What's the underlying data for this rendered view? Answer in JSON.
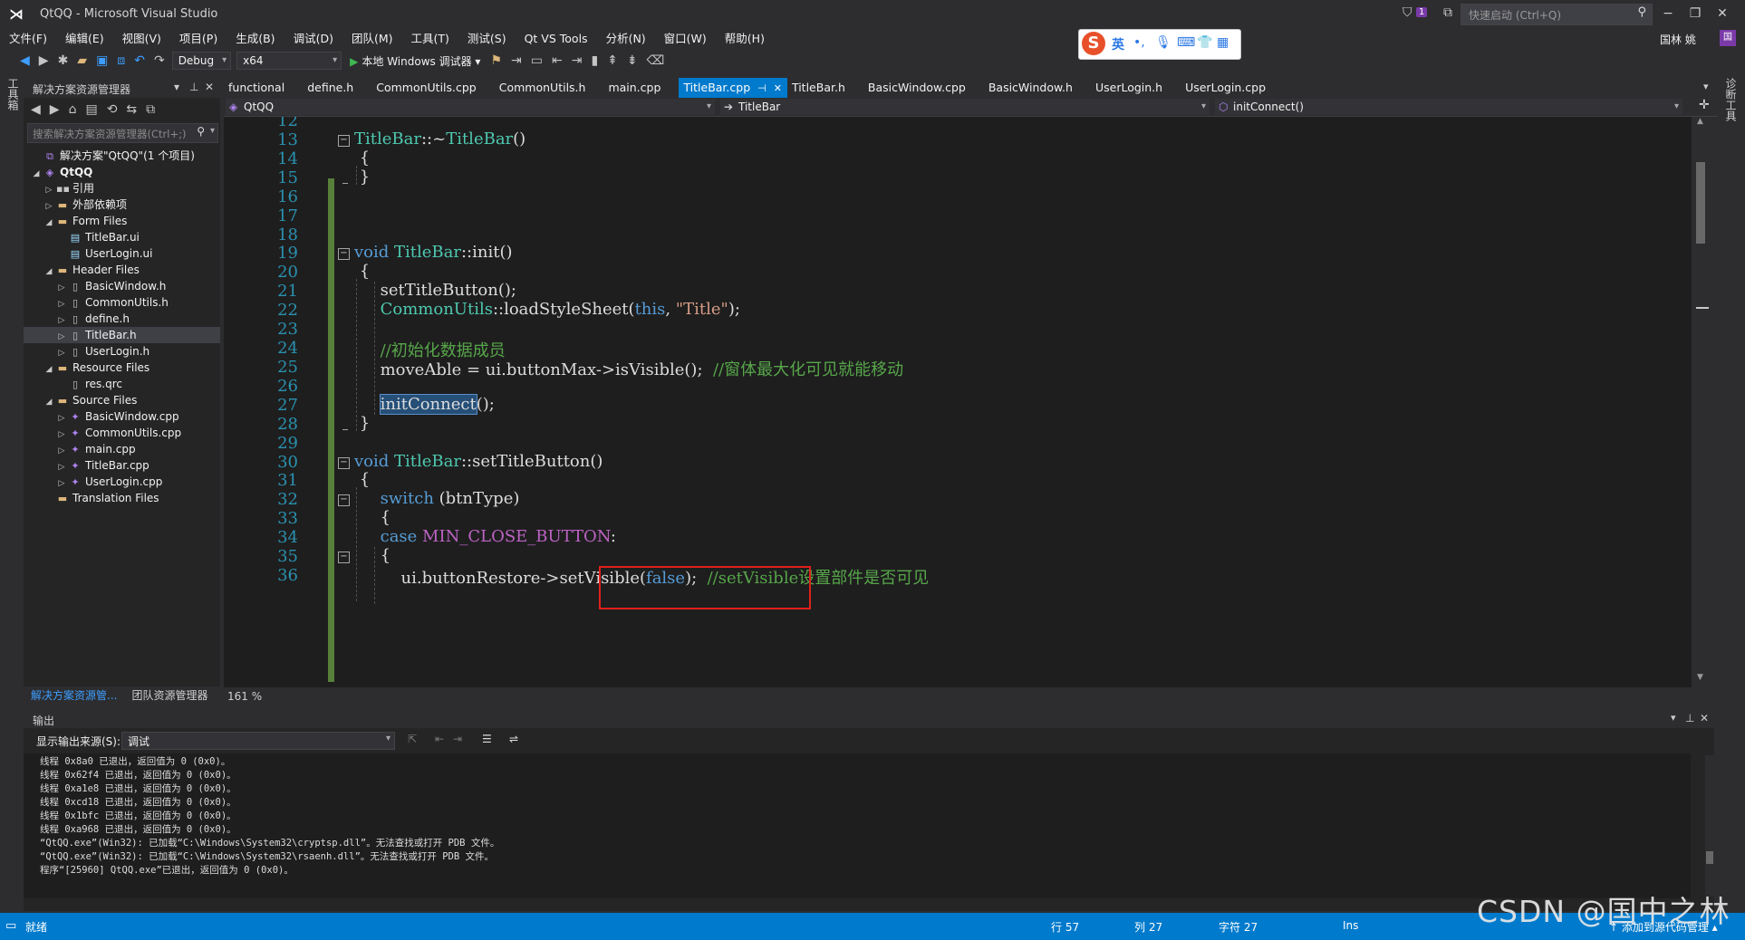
{
  "window": {
    "title": "QtQQ - Microsoft Visual Studio",
    "notification_count": "1"
  },
  "quick_launch": {
    "placeholder": "快速启动 (Ctrl+Q)"
  },
  "user": {
    "name": "国林 姚",
    "avatar": "国"
  },
  "menu": [
    "文件(F)",
    "编辑(E)",
    "视图(V)",
    "项目(P)",
    "生成(B)",
    "调试(D)",
    "团队(M)",
    "工具(T)",
    "测试(S)",
    "Qt VS Tools",
    "分析(N)",
    "窗口(W)",
    "帮助(H)"
  ],
  "ime": {
    "logo": "S",
    "lang": "英"
  },
  "toolbar": {
    "config": "Debug",
    "platform": "x64",
    "run_label": "本地 Windows 调试器"
  },
  "left_strip": {
    "label": "工具箱"
  },
  "right_strip": {
    "label": "诊断工具"
  },
  "solution_explorer": {
    "title": "解决方案资源管理器",
    "search_placeholder": "搜索解决方案资源管理器(Ctrl+;)",
    "tree": [
      {
        "label": "解决方案\"QtQQ\"(1 个项目)",
        "depth": 0,
        "twisty": "",
        "icon": "sln",
        "bold": false,
        "selected": false
      },
      {
        "label": "QtQQ",
        "depth": 0,
        "twisty": "◢",
        "icon": "proj",
        "bold": true,
        "selected": false
      },
      {
        "label": "引用",
        "depth": 1,
        "twisty": "▷",
        "icon": "ref",
        "bold": false,
        "selected": false
      },
      {
        "label": "外部依赖项",
        "depth": 1,
        "twisty": "▷",
        "icon": "folder",
        "bold": false,
        "selected": false
      },
      {
        "label": "Form Files",
        "depth": 1,
        "twisty": "◢",
        "icon": "folder",
        "bold": false,
        "selected": false
      },
      {
        "label": "TitleBar.ui",
        "depth": 2,
        "twisty": "",
        "icon": "ui",
        "bold": false,
        "selected": false
      },
      {
        "label": "UserLogin.ui",
        "depth": 2,
        "twisty": "",
        "icon": "ui",
        "bold": false,
        "selected": false
      },
      {
        "label": "Header Files",
        "depth": 1,
        "twisty": "◢",
        "icon": "folder",
        "bold": false,
        "selected": false
      },
      {
        "label": "BasicWindow.h",
        "depth": 2,
        "twisty": "▷",
        "icon": "h",
        "bold": false,
        "selected": false
      },
      {
        "label": "CommonUtils.h",
        "depth": 2,
        "twisty": "▷",
        "icon": "h",
        "bold": false,
        "selected": false
      },
      {
        "label": "define.h",
        "depth": 2,
        "twisty": "▷",
        "icon": "h",
        "bold": false,
        "selected": false
      },
      {
        "label": "TitleBar.h",
        "depth": 2,
        "twisty": "▷",
        "icon": "h",
        "bold": false,
        "selected": true
      },
      {
        "label": "UserLogin.h",
        "depth": 2,
        "twisty": "▷",
        "icon": "h",
        "bold": false,
        "selected": false
      },
      {
        "label": "Resource Files",
        "depth": 1,
        "twisty": "◢",
        "icon": "folder",
        "bold": false,
        "selected": false
      },
      {
        "label": "res.qrc",
        "depth": 2,
        "twisty": "",
        "icon": "h",
        "bold": false,
        "selected": false
      },
      {
        "label": "Source Files",
        "depth": 1,
        "twisty": "◢",
        "icon": "folder",
        "bold": false,
        "selected": false
      },
      {
        "label": "BasicWindow.cpp",
        "depth": 2,
        "twisty": "▷",
        "icon": "cpp",
        "bold": false,
        "selected": false
      },
      {
        "label": "CommonUtils.cpp",
        "depth": 2,
        "twisty": "▷",
        "icon": "cpp",
        "bold": false,
        "selected": false
      },
      {
        "label": "main.cpp",
        "depth": 2,
        "twisty": "▷",
        "icon": "cpp",
        "bold": false,
        "selected": false
      },
      {
        "label": "TitleBar.cpp",
        "depth": 2,
        "twisty": "▷",
        "icon": "cpp",
        "bold": false,
        "selected": false
      },
      {
        "label": "UserLogin.cpp",
        "depth": 2,
        "twisty": "▷",
        "icon": "cpp",
        "bold": false,
        "selected": false
      },
      {
        "label": "Translation Files",
        "depth": 1,
        "twisty": "",
        "icon": "folder",
        "bold": false,
        "selected": false
      }
    ],
    "bottom_tabs": {
      "active": "解决方案资源管...",
      "inactive": "团队资源管理器"
    }
  },
  "doc_tabs": [
    {
      "label": "functional",
      "active": false
    },
    {
      "label": "define.h",
      "active": false
    },
    {
      "label": "CommonUtils.cpp",
      "active": false
    },
    {
      "label": "CommonUtils.h",
      "active": false
    },
    {
      "label": "main.cpp",
      "active": false
    },
    {
      "label": "TitleBar.cpp",
      "active": true
    },
    {
      "label": "TitleBar.h",
      "active": false
    },
    {
      "label": "BasicWindow.cpp",
      "active": false
    },
    {
      "label": "BasicWindow.h",
      "active": false
    },
    {
      "label": "UserLogin.h",
      "active": false
    },
    {
      "label": "UserLogin.cpp",
      "active": false
    }
  ],
  "navbar": {
    "project": "QtQQ",
    "scope": "TitleBar",
    "member": "initConnect()"
  },
  "editor": {
    "zoom": "161 %",
    "lines": [
      {
        "n": "12",
        "tokens": []
      },
      {
        "n": "13",
        "tokens": [
          [
            "ty",
            "TitleBar"
          ],
          [
            "p",
            "::~"
          ],
          [
            "ty",
            "TitleBar"
          ],
          [
            "p",
            "()"
          ]
        ]
      },
      {
        "n": "14",
        "tokens": [
          [
            "p",
            " {"
          ]
        ]
      },
      {
        "n": "15",
        "tokens": [
          [
            "p",
            " }"
          ]
        ]
      },
      {
        "n": "16",
        "tokens": []
      },
      {
        "n": "17",
        "tokens": []
      },
      {
        "n": "18",
        "tokens": []
      },
      {
        "n": "19",
        "tokens": [
          [
            "kw",
            "void "
          ],
          [
            "ty",
            "TitleBar"
          ],
          [
            "p",
            "::init()"
          ]
        ]
      },
      {
        "n": "20",
        "tokens": [
          [
            "p",
            " {"
          ]
        ]
      },
      {
        "n": "21",
        "tokens": [
          [
            "p",
            "     setTitleButton();"
          ]
        ]
      },
      {
        "n": "22",
        "tokens": [
          [
            "p",
            "     "
          ],
          [
            "ty",
            "CommonUtils"
          ],
          [
            "p",
            "::loadStyleSheet("
          ],
          [
            "kw",
            "this"
          ],
          [
            "p",
            ", "
          ],
          [
            "str",
            "\"Title\""
          ],
          [
            "p",
            ");"
          ]
        ]
      },
      {
        "n": "23",
        "tokens": []
      },
      {
        "n": "24",
        "tokens": [
          [
            "cm",
            "     //初始化数据成员"
          ]
        ]
      },
      {
        "n": "25",
        "tokens": [
          [
            "p",
            "     moveAble = ui.buttonMax->isVisible();  "
          ],
          [
            "cm",
            "//窗体最大化可见就能移动"
          ]
        ]
      },
      {
        "n": "26",
        "tokens": []
      },
      {
        "n": "27",
        "tokens": [
          [
            "p",
            "     "
          ],
          [
            "hl",
            "initConnect"
          ],
          [
            "p",
            "();"
          ]
        ]
      },
      {
        "n": "28",
        "tokens": [
          [
            "p",
            " }"
          ]
        ]
      },
      {
        "n": "29",
        "tokens": []
      },
      {
        "n": "30",
        "tokens": [
          [
            "kw",
            "void "
          ],
          [
            "ty",
            "TitleBar"
          ],
          [
            "p",
            "::setTitleButton()"
          ]
        ]
      },
      {
        "n": "31",
        "tokens": [
          [
            "p",
            " {"
          ]
        ]
      },
      {
        "n": "32",
        "tokens": [
          [
            "kw",
            "     switch "
          ],
          [
            "p",
            "(btnType)"
          ]
        ]
      },
      {
        "n": "33",
        "tokens": [
          [
            "p",
            "     {"
          ]
        ]
      },
      {
        "n": "34",
        "tokens": [
          [
            "kw",
            "     case "
          ],
          [
            "mac",
            "MIN_CLOSE_BUTTON"
          ],
          [
            "p",
            ":"
          ]
        ]
      },
      {
        "n": "35",
        "tokens": [
          [
            "p",
            "     {"
          ]
        ]
      },
      {
        "n": "36",
        "tokens": [
          [
            "p",
            "         ui.buttonRestore->setVisible("
          ],
          [
            "kw",
            "false"
          ],
          [
            "p",
            ");  "
          ],
          [
            "cm",
            "//setVisible设置部件是否可见"
          ]
        ]
      }
    ]
  },
  "output": {
    "title": "输出",
    "source_label": "显示输出来源(S):",
    "source_value": "调试",
    "lines": [
      "线程 0x8a0 已退出，返回值为 0 (0x0)。",
      "线程 0x62f4 已退出，返回值为 0 (0x0)。",
      "线程 0xa1e8 已退出，返回值为 0 (0x0)。",
      "线程 0xcd18 已退出，返回值为 0 (0x0)。",
      "线程 0x1bfc 已退出，返回值为 0 (0x0)。",
      "线程 0xa968 已退出，返回值为 0 (0x0)。",
      "“QtQQ.exe”(Win32): 已加载“C:\\Windows\\System32\\cryptsp.dll”。无法查找或打开 PDB 文件。",
      "“QtQQ.exe”(Win32): 已加载“C:\\Windows\\System32\\rsaenh.dll”。无法查找或打开 PDB 文件。",
      "程序“[25960] QtQQ.exe”已退出，返回值为 0 (0x0)。"
    ]
  },
  "status": {
    "ready": "就绪",
    "line": "行 57",
    "col": "列 27",
    "char": "字符 27",
    "mode": "Ins",
    "source_control": "↑ 添加到源代码管理 ▴"
  },
  "watermark": "CSDN @国中之林",
  "colors": {
    "accent": "#007acc",
    "highlight_box": "#e0201c",
    "change_bar": "#57803a"
  }
}
